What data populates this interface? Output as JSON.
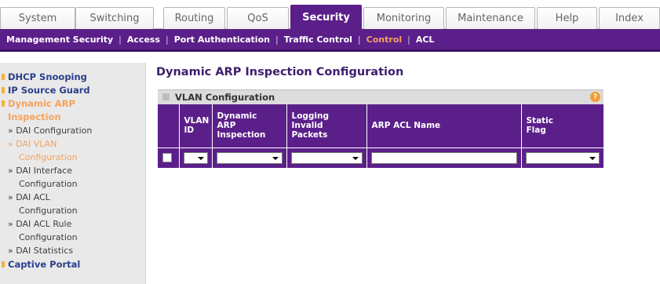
{
  "tabs": [
    "System",
    "Switching",
    "Routing",
    "QoS",
    "Security",
    "Monitoring",
    "Maintenance",
    "Help",
    "Index"
  ],
  "subnav": [
    "Management Security",
    "Access",
    "Port Authentication",
    "Traffic Control",
    "Control",
    "ACL"
  ],
  "sidebar": {
    "dhcp_snooping": "DHCP Snooping",
    "ip_source_guard": "IP Source Guard",
    "dynamic_arp": "Dynamic ARP",
    "inspection": "Inspection",
    "dai_configuration": "» DAI Configuration",
    "dai_vlan": "» DAI VLAN",
    "dai_vlan_cont": "Configuration",
    "dai_interface": "» DAI Interface",
    "dai_interface_cont": "Configuration",
    "dai_acl": "» DAI ACL",
    "dai_acl_cont": "Configuration",
    "dai_acl_rule": "» DAI ACL Rule",
    "dai_acl_rule_cont": "Configuration",
    "dai_statistics": "» DAI Statistics",
    "captive_portal": "Captive Portal"
  },
  "page": {
    "title": "Dynamic ARP Inspection Configuration",
    "section_title": "VLAN Configuration",
    "help_glyph": "?"
  },
  "table": {
    "h_vlan_1": "VLAN",
    "h_vlan_2": "ID",
    "h_dai_1": "Dynamic",
    "h_dai_2": "ARP",
    "h_dai_3": "Inspection",
    "h_log_1": "Logging",
    "h_log_2": "Invalid",
    "h_log_3": "Packets",
    "h_acl": "ARP ACL Name",
    "h_static_1": "Static",
    "h_static_2": "Flag",
    "row": {
      "vlan_id": "",
      "dynamic_arp_inspection": "",
      "logging_invalid_packets": "",
      "arp_acl_name": "",
      "static_flag": ""
    }
  },
  "colors": {
    "brand_purple": "#5b1f8a",
    "active_orange": "#f5a25d",
    "sidebar_blue": "#2b3f8c",
    "help_orange": "#f39c34"
  }
}
